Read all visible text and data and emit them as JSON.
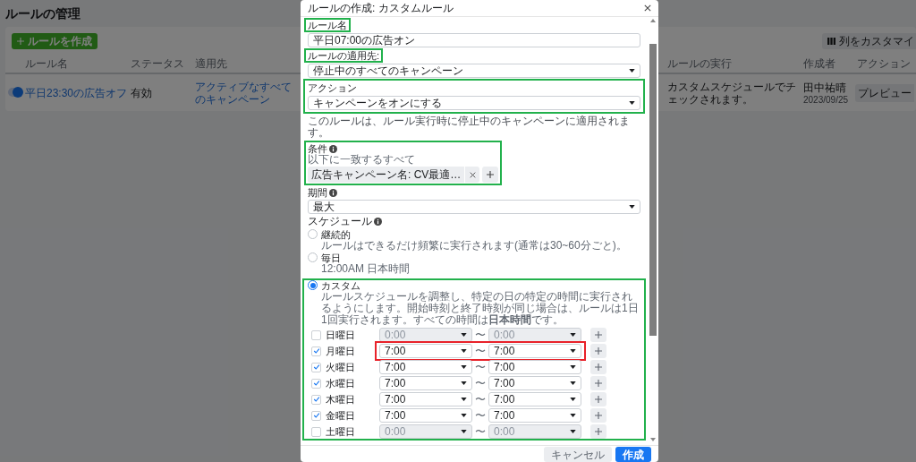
{
  "page": {
    "title": "ルールの管理",
    "create_button": "ルールを作成",
    "customize_button": "列をカスタマイ"
  },
  "table": {
    "columns": [
      "ルール名",
      "ステータス",
      "適用先",
      "ルールの実行",
      "作成者",
      "アクション"
    ],
    "rows": [
      {
        "on": true,
        "name": "平日23:30の広告オフ",
        "status": "有効",
        "target": "アクティブなすべてのキャンペーン",
        "execution": "カスタムスケジュールでチェックされます。",
        "author": "田中祐晴",
        "date": "2023/09/25",
        "action": "プレビュー"
      }
    ]
  },
  "modal": {
    "title": "ルールの作成: カスタムルール",
    "fields": [
      {
        "kind": "input",
        "label": "ルール名",
        "value": "平日07:00の広告オン",
        "highlight": {
          "color": "#22b14c"
        }
      },
      {
        "kind": "select",
        "label": "ルールの適用先:",
        "value": "停止中のすべてのキャンペーン",
        "highlight": {
          "color": "#22b14c"
        }
      },
      {
        "kind": "select",
        "label": "アクション",
        "value": "キャンペーンをオンにする",
        "highlight": {
          "color": "#22b14c"
        }
      }
    ],
    "note": "このルールは、ルール実行時に停止中のキャンペーンに適用されます。",
    "conditions": {
      "label": "条件",
      "sub": "以下に一致するすべて",
      "chips": [
        "広告キャンペーン名: CV最適…"
      ],
      "highlight": {
        "color": "#22b14c"
      }
    },
    "period": {
      "label": "期間",
      "value": "最大"
    },
    "schedule": {
      "label": "スケジュール",
      "options": [
        {
          "label": "継続的",
          "description": "ルールはできるだけ頻繁に実行されます(通常は30~60分ごと)。",
          "selected": false
        },
        {
          "label": "毎日",
          "description": "12:00AM 日本時間",
          "selected": false
        },
        {
          "label": "カスタム",
          "description": "ルールスケジュールを調整し、特定の日の特定の時間に実行されるようにします。開始時刻と終了時刻が同じ場合は、ルールは1日1回実行されます。すべての時間は**日本時間**です。",
          "selected": true,
          "highlight": {
            "color": "#22b14c"
          }
        }
      ],
      "days": [
        {
          "label": "日曜日",
          "checked": false,
          "start": "0:00",
          "separator": "〜",
          "end": "0:00"
        },
        {
          "label": "月曜日",
          "checked": true,
          "start": "7:00",
          "separator": "〜",
          "end": "7:00",
          "highlight": {
            "color": "#e8222a"
          }
        },
        {
          "label": "火曜日",
          "checked": true,
          "start": "7:00",
          "separator": "〜",
          "end": "7:00"
        },
        {
          "label": "水曜日",
          "checked": true,
          "start": "7:00",
          "separator": "〜",
          "end": "7:00"
        },
        {
          "label": "木曜日",
          "checked": true,
          "start": "7:00",
          "separator": "〜",
          "end": "7:00"
        },
        {
          "label": "金曜日",
          "checked": true,
          "start": "7:00",
          "separator": "〜",
          "end": "7:00"
        },
        {
          "label": "土曜日",
          "checked": false,
          "start": "0:00",
          "separator": "〜",
          "end": "0:00"
        }
      ]
    },
    "buttons": {
      "cancel": "キャンセル",
      "create": "作成"
    }
  }
}
